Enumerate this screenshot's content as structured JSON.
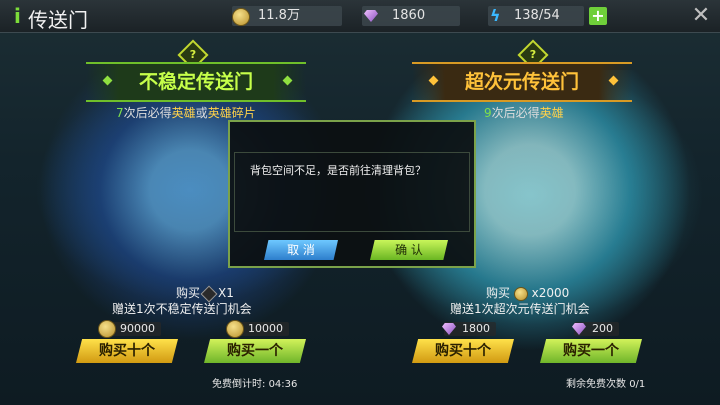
{
  "header": {
    "back_mark": "i",
    "title": "传送门",
    "coins": "11.8万",
    "gems": "1860",
    "energy": "138/54",
    "plus": "+",
    "close": "✕"
  },
  "portals": {
    "left": {
      "qmark": "?",
      "title": "不稳定传送门",
      "guarantee_num": "7",
      "guarantee_text": "次后必得",
      "guarantee_hero": "英雄",
      "guarantee_or": "或",
      "guarantee_fragment": "英雄碎片",
      "buy_label": "购买",
      "buy_qty": "X1",
      "gift": "赠送1次不稳定传送门机会",
      "price_ten": "90000",
      "price_one": "10000",
      "btn_ten": "购买十个",
      "btn_one": "购买一个",
      "footnote_label": "免费倒计时:",
      "footnote_value": "04:36"
    },
    "right": {
      "qmark": "?",
      "title": "超次元传送门",
      "guarantee_num": "9",
      "guarantee_text": "次后必得",
      "guarantee_hero": "英雄",
      "buy_label": "购买",
      "buy_qty": "x2000",
      "gift": "赠送1次超次元传送门机会",
      "price_ten": "1800",
      "price_one": "200",
      "btn_ten": "购买十个",
      "btn_one": "购买一个",
      "footnote_label": "剩余免费次数",
      "footnote_value": "0/1"
    }
  },
  "dialog": {
    "message": "背包空间不足，是否前往清理背包？",
    "cancel": "取 消",
    "confirm": "确 认"
  },
  "colors": {
    "accent_green": "#7fe04a",
    "accent_gold": "#ffc23a",
    "dialog_border": "#7ba24a"
  }
}
